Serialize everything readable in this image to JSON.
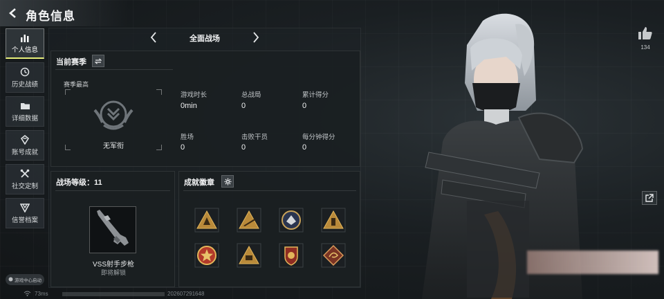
{
  "header": {
    "title": "角色信息"
  },
  "nav": {
    "items": [
      {
        "label": "个人信息",
        "icon": "bar-chart-icon",
        "active": true
      },
      {
        "label": "历史战绩",
        "icon": "history-clock-icon",
        "active": false
      },
      {
        "label": "详细数据",
        "icon": "folder-icon",
        "active": false
      },
      {
        "label": "账号成就",
        "icon": "achievement-icon",
        "active": false
      },
      {
        "label": "社交定制",
        "icon": "tools-icon",
        "active": false
      },
      {
        "label": "信誉档案",
        "icon": "shield-credit-icon",
        "active": false
      }
    ]
  },
  "mode": {
    "label": "全面战场"
  },
  "season": {
    "header": "当前赛季",
    "best_label": "赛季最高",
    "rank_name": "无军衔",
    "stats": [
      {
        "label": "游戏时长",
        "value": "0min"
      },
      {
        "label": "总战局",
        "value": "0"
      },
      {
        "label": "累计得分",
        "value": "0"
      },
      {
        "label": "胜场",
        "value": "0"
      },
      {
        "label": "击败干员",
        "value": "0"
      },
      {
        "label": "每分钟得分",
        "value": "0"
      }
    ]
  },
  "level": {
    "header": "战场等级：11",
    "weapon_name": "VSS射手步枪",
    "weapon_status": "即将解锁"
  },
  "badges": {
    "header": "成就徽章",
    "items": [
      {
        "icon": "triangle-soldier-badge-icon"
      },
      {
        "icon": "triangle-cannon-badge-icon"
      },
      {
        "icon": "round-eagle-badge-icon"
      },
      {
        "icon": "triangle-tower-badge-icon"
      },
      {
        "icon": "round-star-medal-badge-icon"
      },
      {
        "icon": "triangle-vehicle-badge-icon"
      },
      {
        "icon": "shield-emblem-badge-icon"
      },
      {
        "icon": "diamond-dragon-badge-icon"
      }
    ]
  },
  "social": {
    "like_count": "134"
  },
  "footer": {
    "game_center": "游戏中心启动",
    "ping": "73ms",
    "uid": "202607291648"
  },
  "colors": {
    "accent": "#e8f07a",
    "badge_gold": "#d8a84a",
    "badge_red": "#b23a2a",
    "badge_navy": "#2a3550"
  }
}
